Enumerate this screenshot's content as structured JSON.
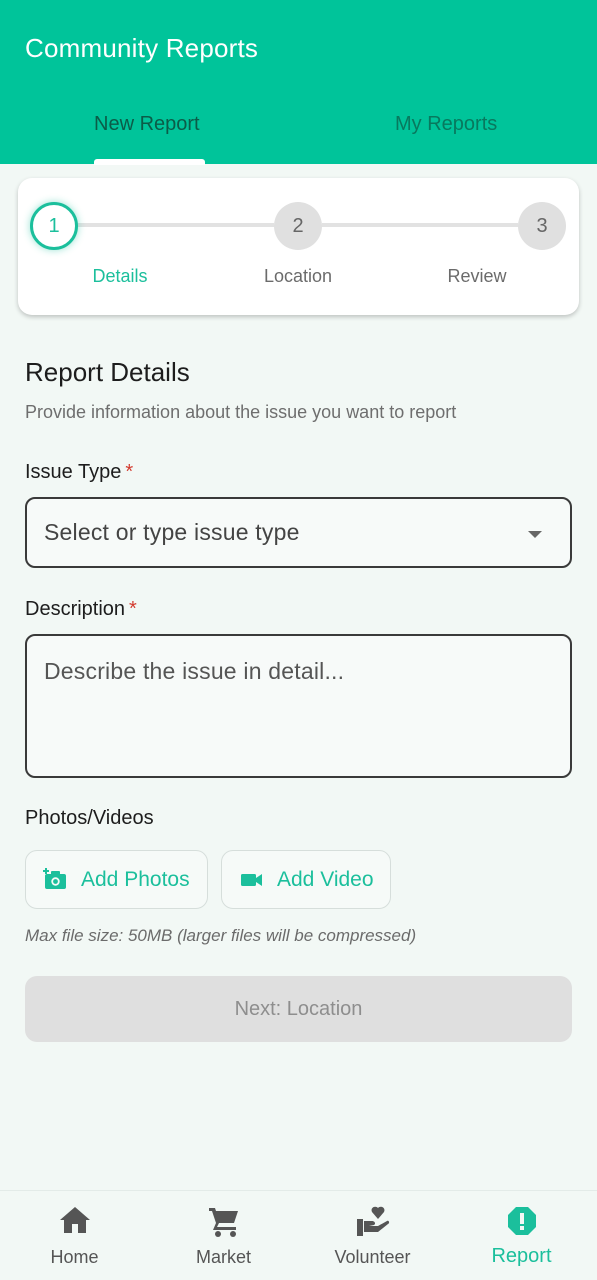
{
  "header": {
    "title": "Community Reports",
    "tabs": [
      {
        "label": "New Report",
        "selected": true
      },
      {
        "label": "My Reports",
        "selected": false
      }
    ]
  },
  "stepper": {
    "steps": [
      {
        "number": "1",
        "label": "Details",
        "active": true
      },
      {
        "number": "2",
        "label": "Location",
        "active": false
      },
      {
        "number": "3",
        "label": "Review",
        "active": false
      }
    ]
  },
  "form": {
    "title": "Report Details",
    "subtitle": "Provide information about the issue you want to report",
    "issue_type": {
      "label": "Issue Type",
      "required_mark": "*",
      "placeholder": "Select or type issue type"
    },
    "description": {
      "label": "Description",
      "required_mark": "*",
      "placeholder": "Describe the issue in detail..."
    },
    "media": {
      "label": "Photos/Videos",
      "add_photos": "Add Photos",
      "add_video": "Add Video",
      "hint": "Max file size: 50MB (larger files will be compressed)"
    },
    "next_button": "Next: Location"
  },
  "bottom_nav": {
    "items": [
      {
        "label": "Home",
        "icon": "home-icon"
      },
      {
        "label": "Market",
        "icon": "cart-icon"
      },
      {
        "label": "Volunteer",
        "icon": "volunteer-heart-hand-icon"
      },
      {
        "label": "Report",
        "icon": "report-alert-icon",
        "active": true
      }
    ]
  },
  "colors": {
    "accent": "#00c49a",
    "accent_text": "#1bbf9c",
    "required": "#d33a2e",
    "disabled_bg": "#dfdfdf"
  }
}
